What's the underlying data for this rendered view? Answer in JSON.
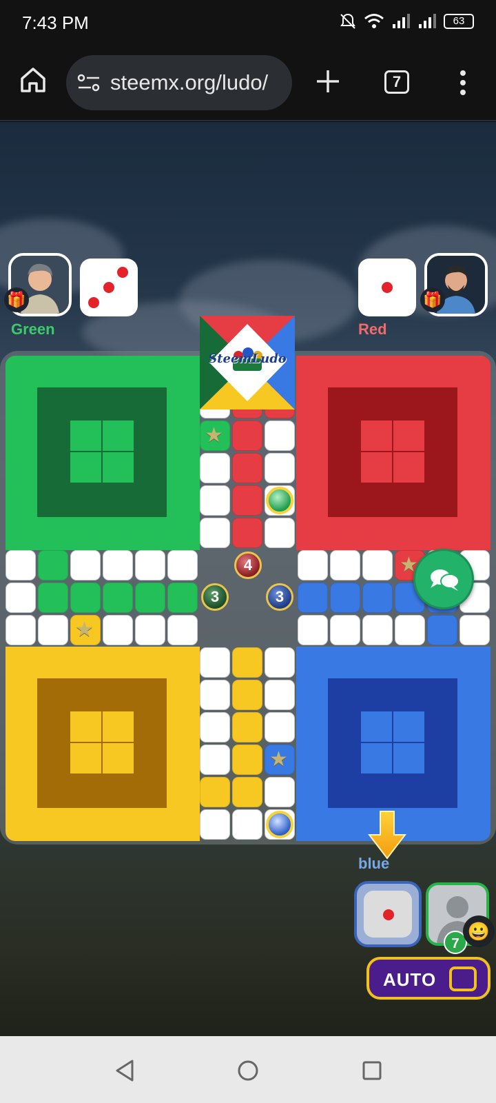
{
  "status_bar": {
    "time": "7:43 PM",
    "battery": "63"
  },
  "browser": {
    "url": "steemx.org/ludo/",
    "tab_count": "7"
  },
  "players": {
    "green": {
      "name": "Green",
      "dice": 3,
      "gift_icon": "🎁"
    },
    "red": {
      "name": "Red",
      "dice": 1,
      "gift_icon": "🎁"
    },
    "blue": {
      "name": "blue",
      "dice": 1,
      "token_count": "7",
      "emoji": "😀"
    }
  },
  "center_tokens": {
    "red": "4",
    "green": "3",
    "blue": "3"
  },
  "logo": "SteemLudo",
  "auto_button": {
    "label": "AUTO"
  },
  "colors": {
    "green": "#23c05a",
    "red": "#e63d44",
    "yellow": "#f8c822",
    "blue": "#3979e3"
  }
}
